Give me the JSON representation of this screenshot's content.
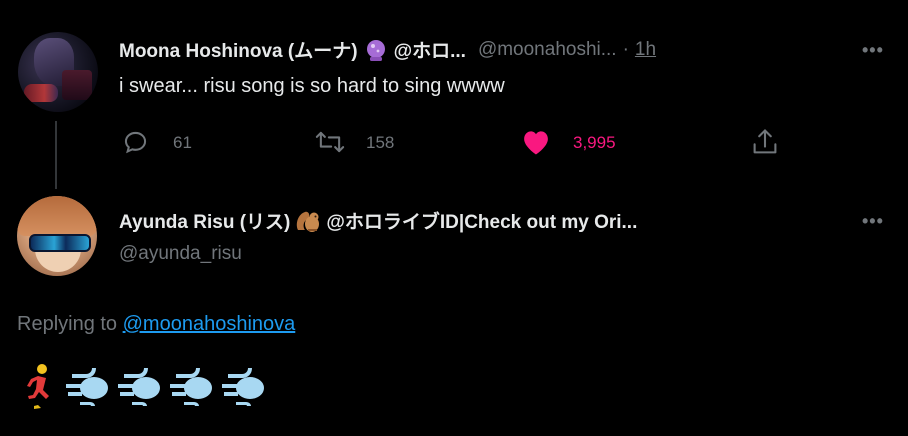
{
  "tweet": {
    "author_name": "Moona Hoshinova (ムーナ)",
    "author_name_suffix": "@ホロ...",
    "emoji": "purple-crystal-ball",
    "handle": "@moonahoshi...",
    "separator": "·",
    "time": "1h",
    "text": "i swear... risu song is so hard to sing wwww",
    "stats": {
      "replies": "61",
      "retweets": "158",
      "likes": "3,995"
    },
    "liked": true
  },
  "reply": {
    "author_name": "Ayunda Risu (リス)",
    "author_name_suffix": "@ホロライブID|Check out my Ori...",
    "emoji": "chipmunk",
    "handle": "@ayunda_risu",
    "replying_prefix": "Replying to",
    "replying_to": "@moonahoshinova",
    "body_emojis": [
      "woman-running",
      "dashing-away",
      "dashing-away",
      "dashing-away",
      "dashing-away"
    ]
  },
  "colors": {
    "background": "#000000",
    "text": "#e7e9ea",
    "secondary": "#71767b",
    "link": "#1d9bf0",
    "like": "#f91880"
  }
}
